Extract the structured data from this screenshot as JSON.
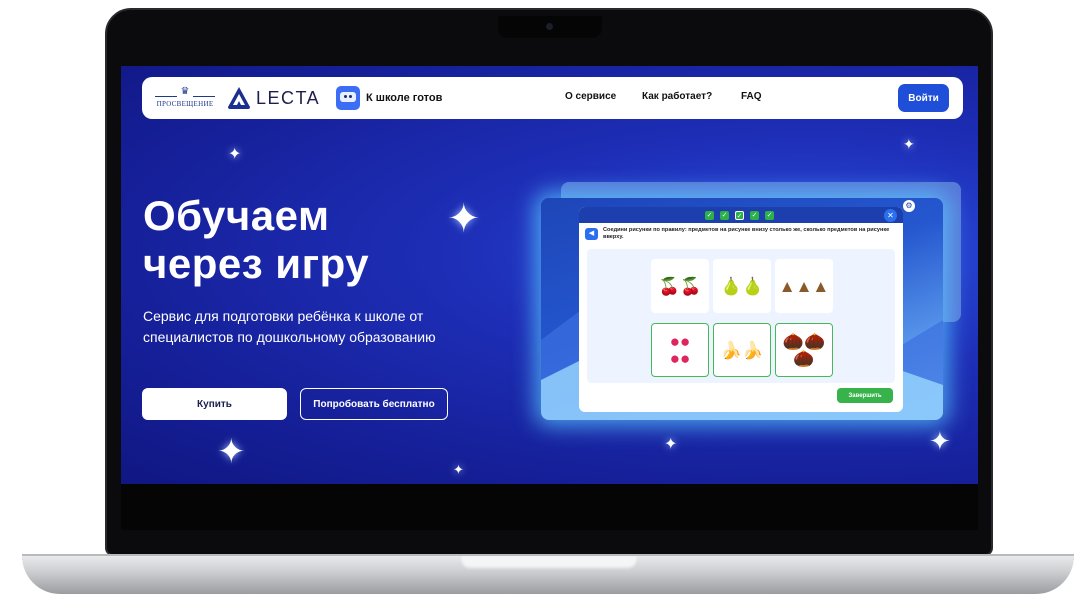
{
  "header": {
    "prosveshchenie_logo_text": "ПРОСВЕЩЕНИЕ",
    "lecta_logo_text": "LECTA",
    "product_name": "К школе готов",
    "nav": [
      "О сервисе",
      "Как работает?",
      "FAQ"
    ],
    "login_label": "Войти"
  },
  "hero": {
    "title_line1": "Обучаем",
    "title_line2": "через игру",
    "subtitle": "Сервис для подготовки ребёнка к школе от специалистов по дошкольному образованию",
    "buy_label": "Купить",
    "try_label": "Попробовать бесплатно"
  },
  "game": {
    "progress_checks": 5,
    "instruction": "Соедини рисунки по правилу: предметов на рисунке внизу столько же, сколько предметов на рисунке вверху.",
    "finish_label": "Завершить",
    "top_row": [
      "cherry",
      "pear",
      "pinecone"
    ],
    "bottom_row": [
      "raspberry",
      "banana",
      "acorn"
    ],
    "icons": {
      "close": "close-icon",
      "sound": "speaker-icon",
      "settings": "gear-icon"
    }
  },
  "colors": {
    "brand_blue": "#1f4fd8",
    "hero_bg": "#16209a",
    "success_green": "#38b24a"
  }
}
